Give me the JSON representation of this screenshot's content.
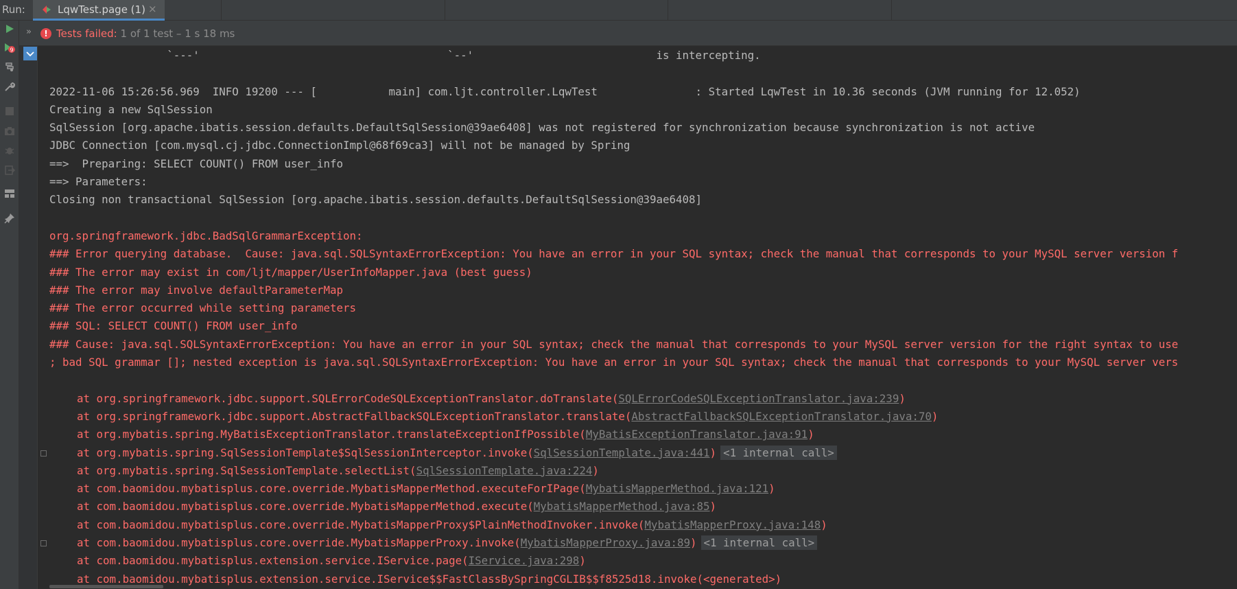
{
  "run": {
    "label": "Run:",
    "tab_label": "LqwTest.page (1)",
    "tab_close": "×",
    "colors": {
      "accent": "#4a88c7",
      "error": "#ff6b68",
      "run_green": "#59a869"
    }
  },
  "status": {
    "chevron": "»",
    "icon": "!",
    "strong": "Tests failed:",
    "detail": " 1 of 1 test – 1 s 18 ms"
  },
  "leftbar": {
    "icons": [
      "run-icon",
      "rerun-failed-icon",
      "toggle-tree-icon",
      "wrench-icon",
      "stop-icon",
      "camera-icon",
      "bug-icon",
      "exit-icon",
      "layout-icon",
      "pin-icon"
    ]
  },
  "console": {
    "lines": [
      {
        "type": "info",
        "text": "                  `---'                                      `--'                            is intercepting."
      },
      {
        "type": "info",
        "text": ""
      },
      {
        "type": "info",
        "text": "2022-11-06 15:26:56.969  INFO 19200 --- [           main] com.ljt.controller.LqwTest               : Started LqwTest in 10.36 seconds (JVM running for 12.052)"
      },
      {
        "type": "info",
        "text": "Creating a new SqlSession"
      },
      {
        "type": "info",
        "text": "SqlSession [org.apache.ibatis.session.defaults.DefaultSqlSession@39ae6408] was not registered for synchronization because synchronization is not active"
      },
      {
        "type": "info",
        "text": "JDBC Connection [com.mysql.cj.jdbc.ConnectionImpl@68f69ca3] will not be managed by Spring"
      },
      {
        "type": "info",
        "text": "==>  Preparing: SELECT COUNT() FROM user_info"
      },
      {
        "type": "info",
        "text": "==> Parameters: "
      },
      {
        "type": "info",
        "text": "Closing non transactional SqlSession [org.apache.ibatis.session.defaults.DefaultSqlSession@39ae6408]"
      },
      {
        "type": "info",
        "text": ""
      },
      {
        "type": "err",
        "text": "org.springframework.jdbc.BadSqlGrammarException: "
      },
      {
        "type": "err",
        "text": "### Error querying database.  Cause: java.sql.SQLSyntaxErrorException: You have an error in your SQL syntax; check the manual that corresponds to your MySQL server version f"
      },
      {
        "type": "err",
        "text": "### The error may exist in com/ljt/mapper/UserInfoMapper.java (best guess)"
      },
      {
        "type": "err",
        "text": "### The error may involve defaultParameterMap"
      },
      {
        "type": "err",
        "text": "### The error occurred while setting parameters"
      },
      {
        "type": "err",
        "text": "### SQL: SELECT COUNT() FROM user_info"
      },
      {
        "type": "err",
        "text": "### Cause: java.sql.SQLSyntaxErrorException: You have an error in your SQL syntax; check the manual that corresponds to your MySQL server version for the right syntax to use"
      },
      {
        "type": "err",
        "text": "; bad SQL grammar []; nested exception is java.sql.SQLSyntaxErrorException: You have an error in your SQL syntax; check the manual that corresponds to your MySQL server vers"
      },
      {
        "type": "info",
        "text": ""
      },
      {
        "type": "st",
        "prefix": "at org.springframework.jdbc.support.SQLErrorCodeSQLExceptionTranslator.doTranslate(",
        "link": "SQLErrorCodeSQLExceptionTranslator.java:239",
        "suffix": ")"
      },
      {
        "type": "st",
        "prefix": "at org.springframework.jdbc.support.AbstractFallbackSQLExceptionTranslator.translate(",
        "link": "AbstractFallbackSQLExceptionTranslator.java:70",
        "suffix": ")"
      },
      {
        "type": "st",
        "prefix": "at org.mybatis.spring.MyBatisExceptionTranslator.translateExceptionIfPossible(",
        "link": "MyBatisExceptionTranslator.java:91",
        "suffix": ")"
      },
      {
        "type": "st",
        "prefix": "at org.mybatis.spring.SqlSessionTemplate$SqlSessionInterceptor.invoke(",
        "link": "SqlSessionTemplate.java:441",
        "suffix": ")",
        "internal": "<1 internal call>",
        "expander": true
      },
      {
        "type": "st",
        "prefix": "at org.mybatis.spring.SqlSessionTemplate.selectList(",
        "link": "SqlSessionTemplate.java:224",
        "suffix": ")"
      },
      {
        "type": "st",
        "prefix": "at com.baomidou.mybatisplus.core.override.MybatisMapperMethod.executeForIPage(",
        "link": "MybatisMapperMethod.java:121",
        "suffix": ")"
      },
      {
        "type": "st",
        "prefix": "at com.baomidou.mybatisplus.core.override.MybatisMapperMethod.execute(",
        "link": "MybatisMapperMethod.java:85",
        "suffix": ")"
      },
      {
        "type": "st",
        "prefix": "at com.baomidou.mybatisplus.core.override.MybatisMapperProxy$PlainMethodInvoker.invoke(",
        "link": "MybatisMapperProxy.java:148",
        "suffix": ")"
      },
      {
        "type": "st",
        "prefix": "at com.baomidou.mybatisplus.core.override.MybatisMapperProxy.invoke(",
        "link": "MybatisMapperProxy.java:89",
        "suffix": ")",
        "internal": "<1 internal call>",
        "expander": true
      },
      {
        "type": "st",
        "prefix": "at com.baomidou.mybatisplus.extension.service.IService.page(",
        "link": "IService.java:298",
        "suffix": ")"
      },
      {
        "type": "st",
        "prefix": "at com.baomidou.mybatisplus.extension.service.IService$$FastClassBySpringCGLIB$$f8525d18.invoke(<generated>)"
      }
    ]
  }
}
